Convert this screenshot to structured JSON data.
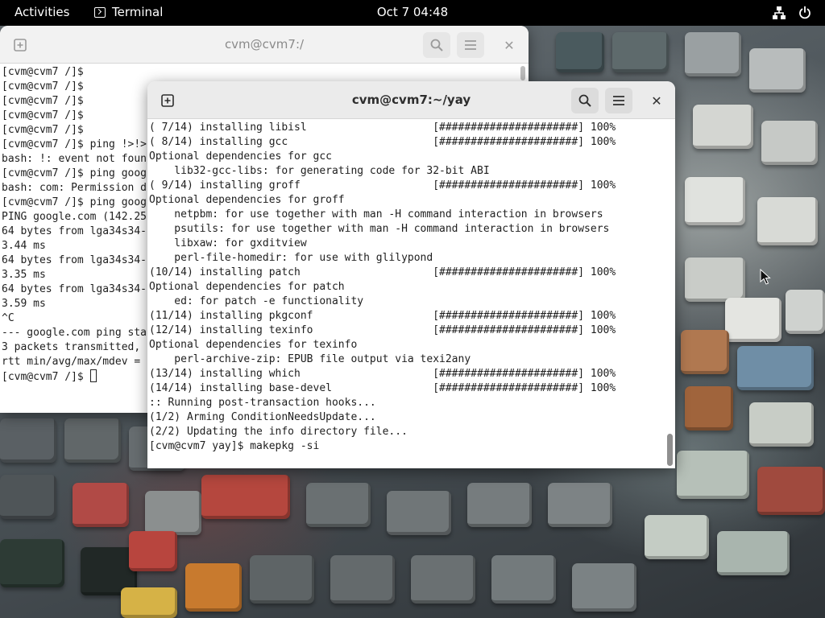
{
  "topbar": {
    "activities": "Activities",
    "app_name": "Terminal",
    "clock": "Oct 7  04:48",
    "icons": [
      "network-icon",
      "power-icon"
    ]
  },
  "back_window": {
    "title": "cvm@cvm7:/",
    "lines": [
      "[cvm@cvm7 /]$",
      "[cvm@cvm7 /]$",
      "[cvm@cvm7 /]$",
      "[cvm@cvm7 /]$",
      "[cvm@cvm7 /]$",
      "[cvm@cvm7 /]$ ping !>!>",
      "bash: !: event not foun",
      "[cvm@cvm7 /]$ ping goog",
      "bash: com: Permission d",
      "[cvm@cvm7 /]$ ping goog",
      "PING google.com (142.25",
      "64 bytes from lga34s34-",
      "3.44 ms",
      "64 bytes from lga34s34-",
      "3.35 ms",
      "64 bytes from lga34s34-",
      "3.59 ms",
      "^C",
      "--- google.com ping sta",
      "3 packets transmitted,",
      "rtt min/avg/max/mdev =",
      "[cvm@cvm7 /]$ "
    ]
  },
  "front_window": {
    "title": "cvm@cvm7:~/yay",
    "lines": [
      "( 7/14) installing libisl                    [######################] 100%",
      "( 8/14) installing gcc                       [######################] 100%",
      "Optional dependencies for gcc",
      "    lib32-gcc-libs: for generating code for 32-bit ABI",
      "( 9/14) installing groff                     [######################] 100%",
      "Optional dependencies for groff",
      "    netpbm: for use together with man -H command interaction in browsers",
      "    psutils: for use together with man -H command interaction in browsers",
      "    libxaw: for gxditview",
      "    perl-file-homedir: for use with glilypond",
      "(10/14) installing patch                     [######################] 100%",
      "Optional dependencies for patch",
      "    ed: for patch -e functionality",
      "(11/14) installing pkgconf                   [######################] 100%",
      "(12/14) installing texinfo                   [######################] 100%",
      "Optional dependencies for texinfo",
      "    perl-archive-zip: EPUB file output via texi2any",
      "(13/14) installing which                     [######################] 100%",
      "(14/14) installing base-devel                [######################] 100%",
      ":: Running post-transaction hooks...",
      "(1/2) Arming ConditionNeedsUpdate...",
      "(2/2) Updating the info directory file...",
      "[cvm@cvm7 yay]$ makepkg -si"
    ]
  }
}
